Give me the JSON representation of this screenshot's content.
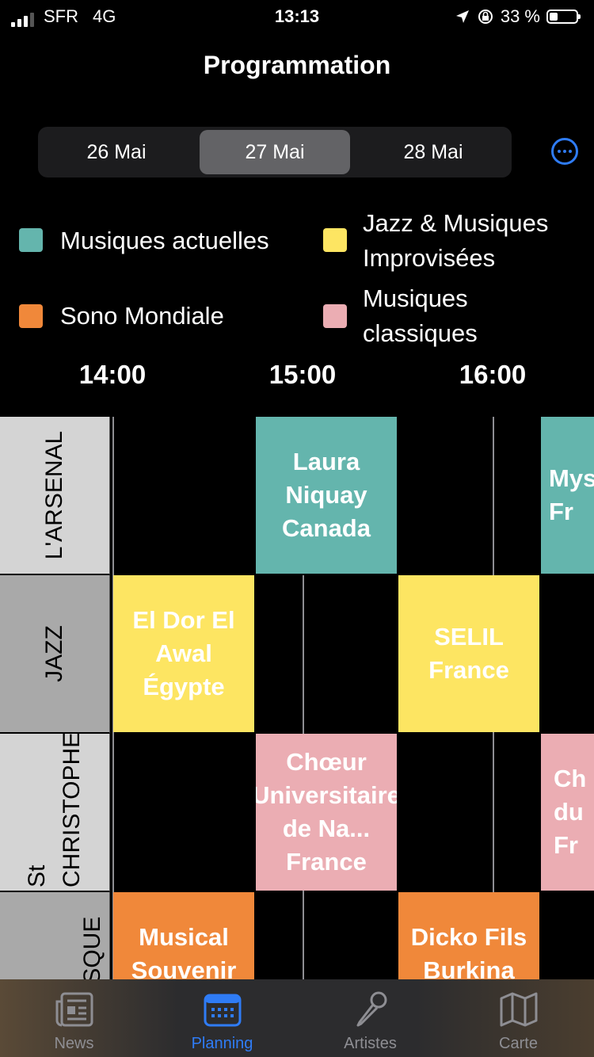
{
  "status": {
    "carrier": "SFR",
    "network": "4G",
    "time": "13:13",
    "battery": "33 %"
  },
  "header": {
    "title": "Programmation"
  },
  "dates": [
    "26 Mai",
    "27 Mai",
    "28 Mai"
  ],
  "legend": [
    {
      "label": "Musiques actuelles",
      "color": "#64b5ad"
    },
    {
      "label": "Jazz & Musiques Improvisées",
      "color": "#fde562"
    },
    {
      "label": "Sono Mondiale",
      "color": "#f0883a"
    },
    {
      "label": "Musiques classiques",
      "color": "#ebadb3"
    }
  ],
  "times": [
    "14:00",
    "15:00",
    "16:00"
  ],
  "rooms": [
    "L'ARSENAL",
    "JAZZ",
    "St CHRISTOPHE",
    "KIOSQUE"
  ],
  "events": {
    "arsenal_1": "Laura Niquay Canada",
    "arsenal_2": "Mys Fr",
    "jazz_1": "El Dor El Awal Égypte",
    "jazz_2": "SELIL France",
    "christophe_1": "Chœur Universitaire de Na... France",
    "christophe_2": "Ch du Fr",
    "kiosque_1": "Musical Souvenir",
    "kiosque_2": "Dicko Fils Burkina"
  },
  "tabs": [
    {
      "label": "News",
      "icon": "newspaper-icon"
    },
    {
      "label": "Planning",
      "icon": "calendar-icon"
    },
    {
      "label": "Artistes",
      "icon": "microphone-icon"
    },
    {
      "label": "Carte",
      "icon": "map-icon"
    }
  ]
}
